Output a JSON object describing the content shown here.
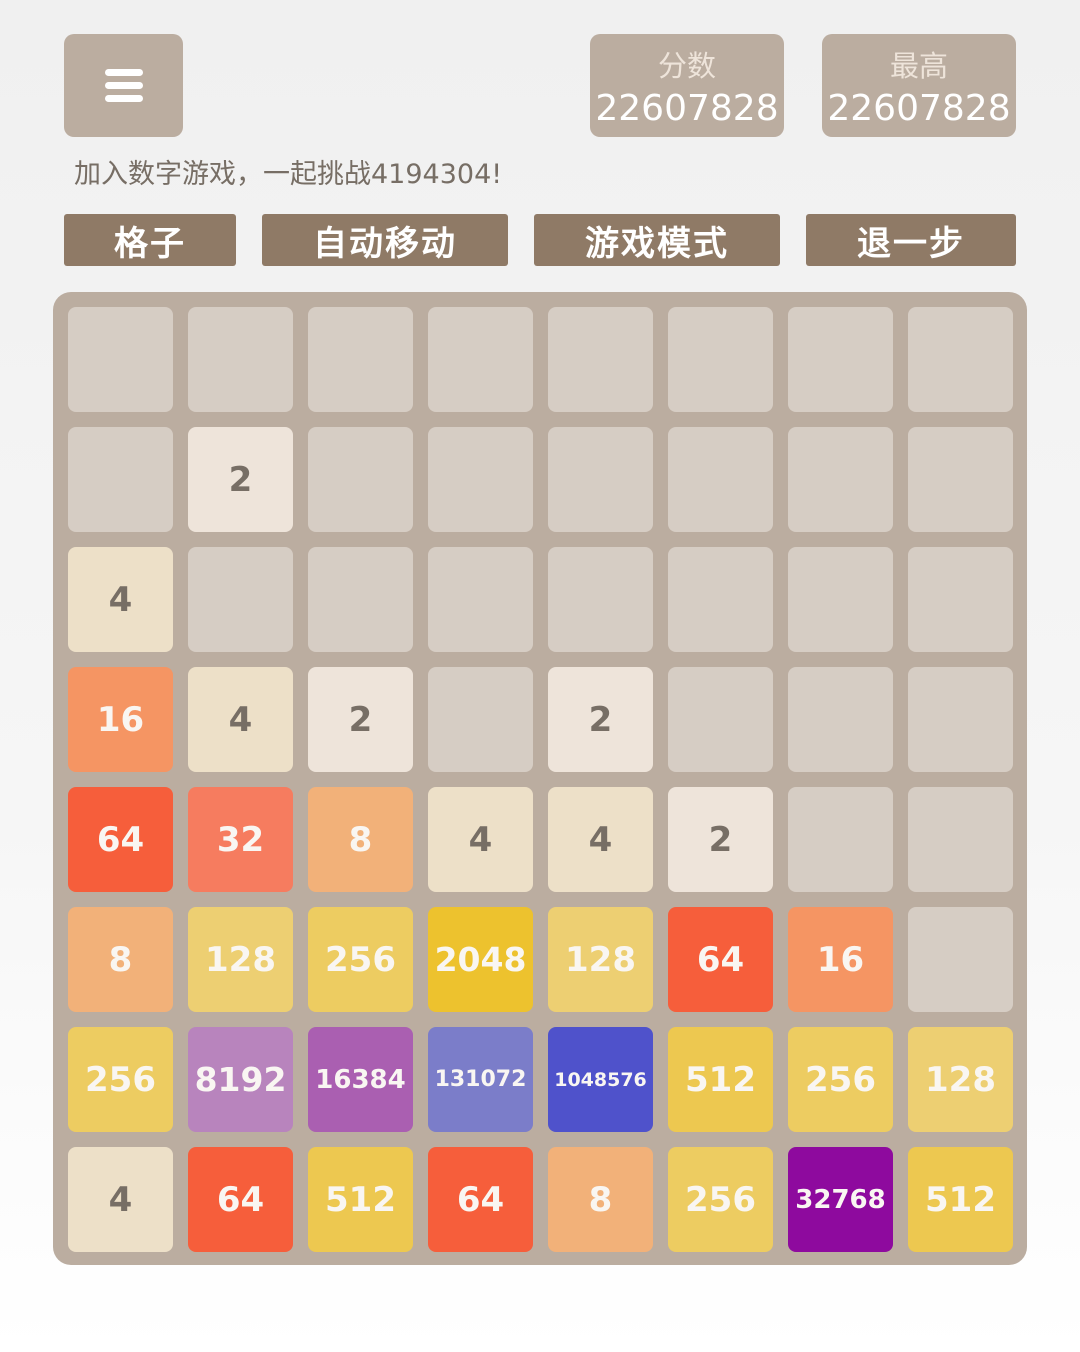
{
  "header": {
    "menu_icon": "hamburger-menu-icon",
    "score_label": "分数",
    "score_value": "22607828",
    "best_label": "最高",
    "best_value": "22607828",
    "tagline": "加入数字游戏，一起挑战4194304!"
  },
  "actions": {
    "grid_label": "格子",
    "auto_label": "自动移动",
    "mode_label": "游戏模式",
    "undo_label": "退一步"
  },
  "board": {
    "size": 8,
    "rows": [
      [
        null,
        null,
        null,
        null,
        null,
        null,
        null,
        null
      ],
      [
        null,
        2,
        null,
        null,
        null,
        null,
        null,
        null
      ],
      [
        4,
        null,
        null,
        null,
        null,
        null,
        null,
        null
      ],
      [
        16,
        4,
        2,
        null,
        2,
        null,
        null,
        null
      ],
      [
        64,
        32,
        8,
        4,
        4,
        2,
        null,
        null
      ],
      [
        8,
        128,
        256,
        2048,
        128,
        64,
        16,
        null
      ],
      [
        256,
        8192,
        16384,
        131072,
        1048576,
        512,
        256,
        128
      ],
      [
        4,
        64,
        512,
        64,
        8,
        256,
        32768,
        512
      ]
    ]
  },
  "colors": {
    "board_bg": "#bbada0",
    "empty_cell": "#d6cdc4",
    "button_bg": "#8f7a66",
    "tile_palette": {
      "2": {
        "bg": "#eee4da",
        "fg": "#776e65"
      },
      "4": {
        "bg": "#ede0c8",
        "fg": "#776e65"
      },
      "8": {
        "bg": "#f2b179",
        "fg": "#f9f6f2"
      },
      "16": {
        "bg": "#f59563",
        "fg": "#f9f6f2"
      },
      "32": {
        "bg": "#f67c5f",
        "fg": "#f9f6f2"
      },
      "64": {
        "bg": "#f65e3b",
        "fg": "#f9f6f2"
      },
      "128": {
        "bg": "#edcf72",
        "fg": "#f9f6f2"
      },
      "256": {
        "bg": "#edcc61",
        "fg": "#f9f6f2"
      },
      "512": {
        "bg": "#edc850",
        "fg": "#f9f6f2"
      },
      "2048": {
        "bg": "#edc22e",
        "fg": "#f9f6f2"
      },
      "8192": {
        "bg": "#b884bd",
        "fg": "#f9f6f2"
      },
      "16384": {
        "bg": "#aa5fb1",
        "fg": "#f9f6f2"
      },
      "32768": {
        "bg": "#8e0a9e",
        "fg": "#f9f6f2"
      },
      "131072": {
        "bg": "#7b7dc9",
        "fg": "#f9f6f2"
      },
      "1048576": {
        "bg": "#4f52cb",
        "fg": "#f9f6f2"
      }
    }
  }
}
